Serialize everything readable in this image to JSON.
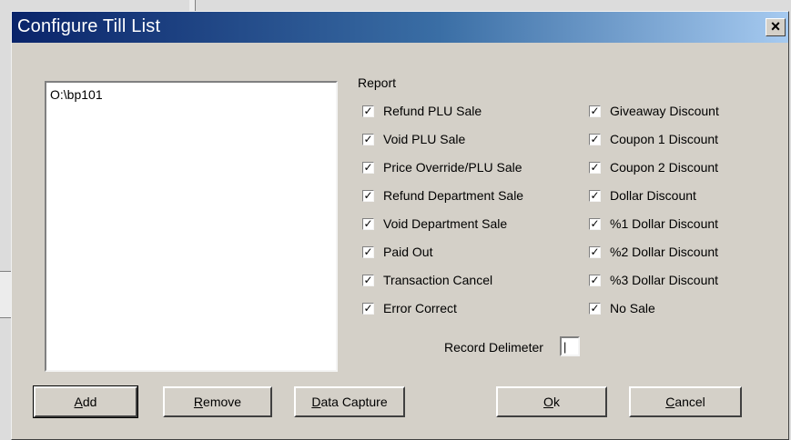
{
  "window": {
    "title": "Configure Till List",
    "close_glyph": "×"
  },
  "till_list": {
    "items": [
      "O:\\bp101"
    ]
  },
  "report": {
    "label": "Report",
    "left_column": [
      {
        "label": "Refund PLU Sale",
        "checked": true
      },
      {
        "label": "Void PLU Sale",
        "checked": true
      },
      {
        "label": "Price Override/PLU Sale",
        "checked": true
      },
      {
        "label": "Refund Department Sale",
        "checked": true
      },
      {
        "label": "Void Department Sale",
        "checked": true
      },
      {
        "label": "Paid Out",
        "checked": true
      },
      {
        "label": "Transaction Cancel",
        "checked": true
      },
      {
        "label": "Error Correct",
        "checked": true
      }
    ],
    "right_column": [
      {
        "label": "Giveaway Discount",
        "checked": true
      },
      {
        "label": "Coupon 1 Discount",
        "checked": true
      },
      {
        "label": "Coupon 2 Discount",
        "checked": true
      },
      {
        "label": "Dollar Discount",
        "checked": true
      },
      {
        "label": "%1 Dollar Discount",
        "checked": true
      },
      {
        "label": "%2 Dollar Discount",
        "checked": true
      },
      {
        "label": "%3 Dollar Discount",
        "checked": true
      },
      {
        "label": "No Sale",
        "checked": true
      }
    ],
    "check_glyph": "✓"
  },
  "record_delimeter": {
    "label": "Record Delimeter",
    "value": "|"
  },
  "buttons": {
    "add": {
      "mnemonic": "A",
      "rest": "dd"
    },
    "remove": {
      "mnemonic": "R",
      "rest": "emove"
    },
    "data_capture": {
      "mnemonic": "D",
      "rest": "ata Capture"
    },
    "ok": {
      "mnemonic": "O",
      "rest": "k"
    },
    "cancel": {
      "mnemonic": "C",
      "rest": "ancel"
    }
  }
}
